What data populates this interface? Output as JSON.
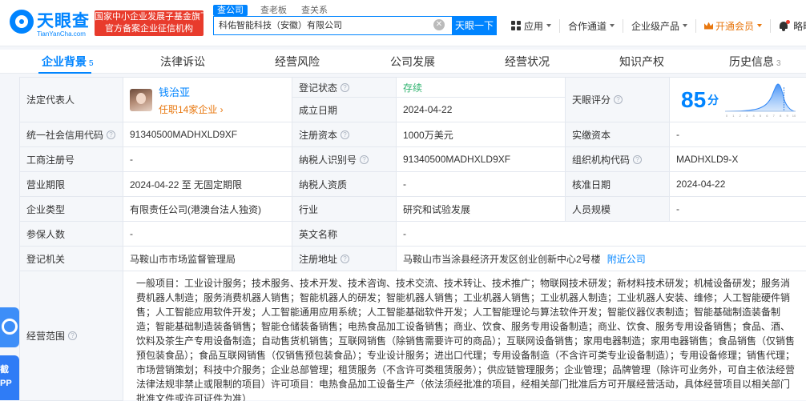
{
  "header": {
    "logo_name": "天眼查",
    "logo_url": "TianYanCha.com",
    "fund_badge_line1": "国家中小企业发展子基金旗下",
    "fund_badge_line2": "官方备案企业征信机构",
    "search_tabs": [
      "查公司",
      "查老板",
      "查关系"
    ],
    "search_value": "科佑智能科技（安徽）有限公司",
    "search_button": "天眼一下",
    "nav": {
      "apps": "应用",
      "channel": "合作通道",
      "enterprise": "企业级产品",
      "vip": "开通会员",
      "user": "略略..."
    }
  },
  "tabs": [
    {
      "label": "企业背景",
      "count": "5"
    },
    {
      "label": "法律诉讼",
      "count": ""
    },
    {
      "label": "经营风险",
      "count": ""
    },
    {
      "label": "公司发展",
      "count": ""
    },
    {
      "label": "经营状况",
      "count": ""
    },
    {
      "label": "知识产权",
      "count": ""
    },
    {
      "label": "历史信息",
      "count": "3"
    }
  ],
  "info": {
    "legal_rep": {
      "label": "法定代表人",
      "name": "钱治亚",
      "sub": "任职14家企业 ›"
    },
    "reg_status": {
      "label": "登记状态",
      "value": "存续"
    },
    "founded": {
      "label": "成立日期",
      "value": "2024-04-22"
    },
    "score": {
      "label": "天眼评分",
      "value": "85",
      "unit": "分",
      "axis": [
        "0",
        "1",
        "2",
        "3",
        "4",
        "5",
        "6",
        "7",
        "8",
        "9",
        "10"
      ],
      "level": 0.85
    },
    "credit_code": {
      "label": "统一社会信用代码",
      "value": "91340500MADHXLD9XF"
    },
    "reg_capital": {
      "label": "注册资本",
      "value": "1000万美元"
    },
    "paid_capital": {
      "label": "实缴资本",
      "value": "-"
    },
    "biz_reg_no": {
      "label": "工商注册号",
      "value": "-"
    },
    "taxpayer_id": {
      "label": "纳税人识别号",
      "value": "91340500MADHXLD9XF"
    },
    "org_code": {
      "label": "组织机构代码",
      "value": "MADHXLD9-X"
    },
    "biz_term": {
      "label": "营业期限",
      "value": "2024-04-22 至 无固定期限"
    },
    "taxpayer_qual": {
      "label": "纳税人资质",
      "value": "-"
    },
    "approve_date": {
      "label": "核准日期",
      "value": "2024-04-22"
    },
    "company_type": {
      "label": "企业类型",
      "value": "有限责任公司(港澳台法人独资)"
    },
    "industry": {
      "label": "行业",
      "value": "研究和试验发展"
    },
    "staff_size": {
      "label": "人员规模",
      "value": "-"
    },
    "insured": {
      "label": "参保人数",
      "value": "-"
    },
    "english_name": {
      "label": "英文名称",
      "value": "-"
    },
    "reg_authority": {
      "label": "登记机关",
      "value": "马鞍山市市场监督管理局"
    },
    "reg_address": {
      "label": "注册地址",
      "value": "马鞍山市当涂县经济开发区创业创新中心2号楼",
      "link": "附近公司"
    },
    "scope": {
      "label": "经营范围",
      "value": "一般项目：工业设计服务；技术服务、技术开发、技术咨询、技术交流、技术转让、技术推广；物联网技术研发；新材料技术研发；机械设备研发；服务消费机器人制造；服务消费机器人销售；智能机器人的研发；智能机器人销售；工业机器人销售；工业机器人制造；工业机器人安装、维修；人工智能硬件销售；人工智能应用软件开发；人工智能通用应用系统；人工智能基础软件开发；人工智能理论与算法软件开发；智能仪器仪表制造；智能基础制造装备制造；智能基础制造装备销售；智能仓储装备销售；电热食品加工设备销售；商业、饮食、服务专用设备制造；商业、饮食、服务专用设备销售；食品、酒、饮料及茶生产专用设备制造；自动售货机销售；互联网销售（除销售需要许可的商品）；互联网设备销售；家用电器制造；家用电器销售；食品销售（仅销售预包装食品）；食品互联网销售（仅销售预包装食品）；专业设计服务；进出口代理；专用设备制造（不含许可类专业设备制造）；专用设备修理；销售代理；市场营销策划；科技中介服务；企业总部管理；租赁服务（不含许可类租赁服务）；供应链管理服务；企业管理；品牌管理（除许可业务外，可自主依法经营法律法规非禁止或限制的项目）许可项目：电热食品加工设备生产（依法须经批准的项目，经相关部门批准后方可开展经营活动，具体经营项目以相关部门批准文件或许可证件为准）"
    }
  },
  "side_widgets": {
    "promo_line1": "截",
    "promo_line2": "PP"
  },
  "colors": {
    "brand": "#0084ff",
    "badge_red": "#e83b2c",
    "vip_orange": "#e8770e",
    "status_green": "#2fb36f"
  }
}
